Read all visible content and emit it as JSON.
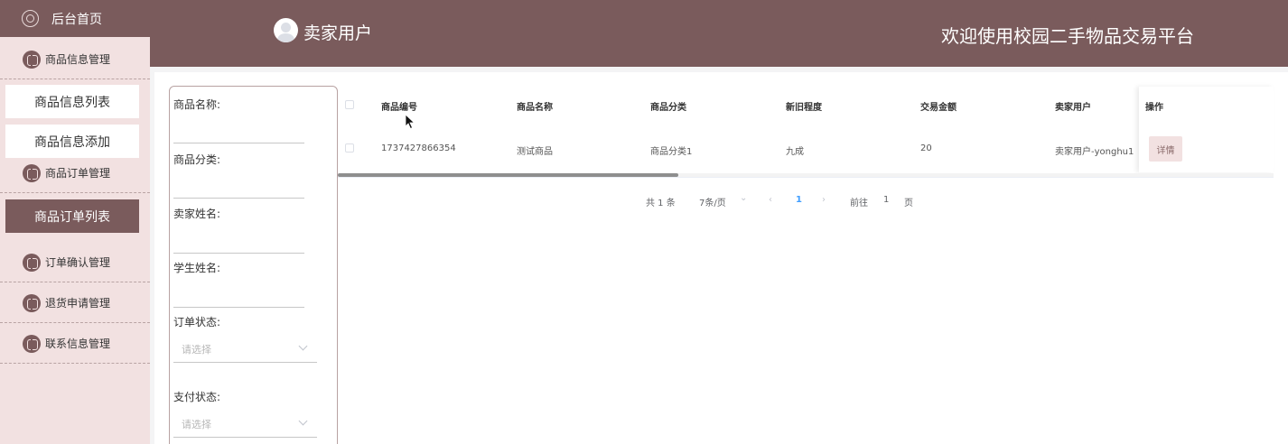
{
  "sidebar": {
    "home_label": "后台首页",
    "groups": [
      {
        "label": "商品信息管理"
      },
      {
        "label": "商品订单管理"
      },
      {
        "label": "订单确认管理"
      },
      {
        "label": "退货申请管理"
      },
      {
        "label": "联系信息管理"
      }
    ],
    "sub_items": [
      {
        "label": "商品信息列表"
      },
      {
        "label": "商品信息添加"
      },
      {
        "label": "商品订单列表"
      }
    ]
  },
  "header": {
    "user_label": "卖家用户",
    "welcome_text": "欢迎使用校园二手物品交易平台"
  },
  "filter": {
    "fields": [
      {
        "label": "商品名称:"
      },
      {
        "label": "商品分类:"
      },
      {
        "label": "卖家姓名:"
      },
      {
        "label": "学生姓名:"
      },
      {
        "label": "订单状态:",
        "placeholder": "请选择"
      },
      {
        "label": "支付状态:",
        "placeholder": "请选择"
      }
    ]
  },
  "table": {
    "columns": [
      "商品编号",
      "商品名称",
      "商品分类",
      "新旧程度",
      "交易金额",
      "卖家用户",
      "操作"
    ],
    "rows": [
      {
        "cells": [
          "1737427866354",
          "测试商品",
          "商品分类1",
          "九成",
          "20",
          "卖家用户-yonghu1"
        ],
        "action": "详情"
      }
    ]
  },
  "pagination": {
    "total": "共 1 条",
    "page_size": "7条/页",
    "prev": "‹",
    "current": "1",
    "next": "›",
    "goto_prefix": "前往",
    "goto_value": "1",
    "goto_suffix": "页"
  },
  "colors": {
    "primary": "#7a5b5c",
    "sidebar_bg": "#f2e1e1",
    "accent": "#409eff"
  }
}
